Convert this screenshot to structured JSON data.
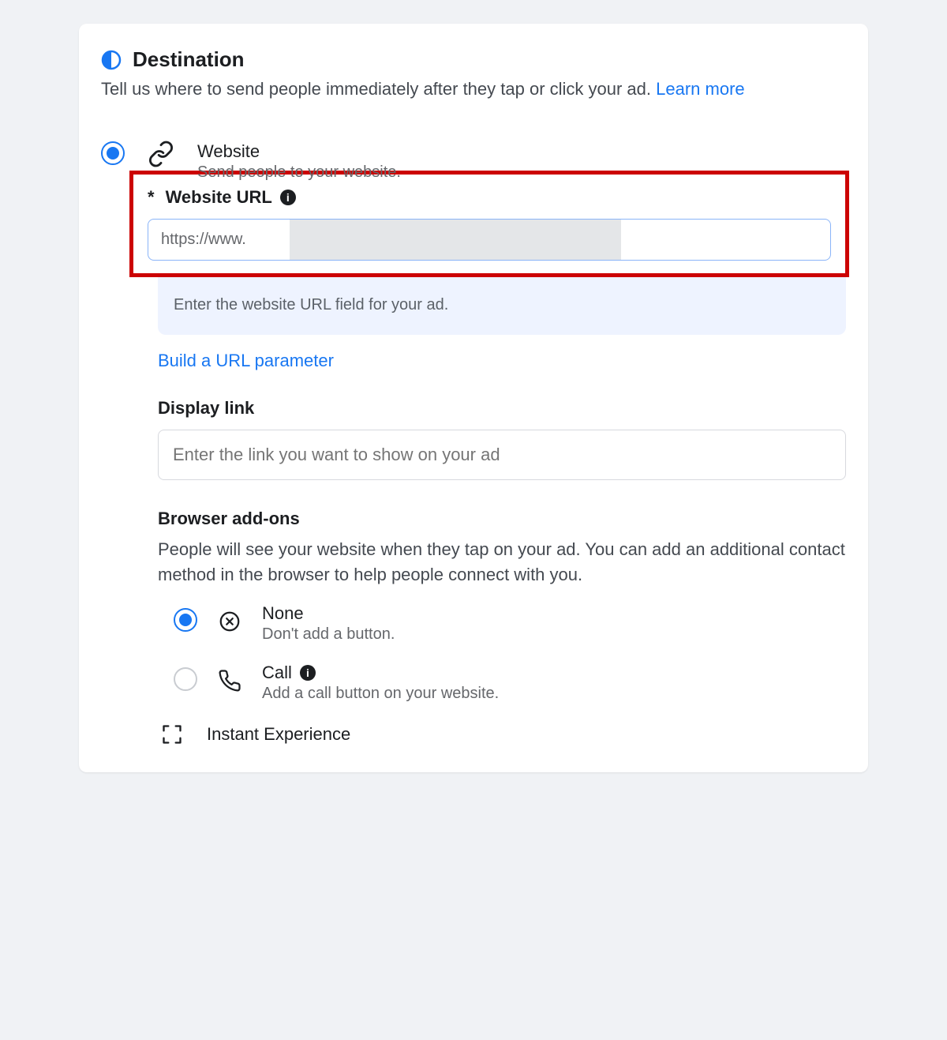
{
  "header": {
    "title": "Destination",
    "description_pre": "Tell us where to send people immediately after they tap or click your ad. ",
    "learn_more": "Learn more"
  },
  "website_option": {
    "label": "Website",
    "desc": "Send people to your website."
  },
  "url_field": {
    "label": "Website URL",
    "value": "https://www.",
    "helper": "Enter the website URL field for your ad."
  },
  "url_param_link": "Build a URL parameter",
  "display_link": {
    "label": "Display link",
    "placeholder": "Enter the link you want to show on your ad"
  },
  "addons": {
    "heading": "Browser add-ons",
    "desc": "People will see your website when they tap on your ad. You can add an additional contact method in the browser to help people connect with you.",
    "none": {
      "label": "None",
      "desc": "Don't add a button."
    },
    "call": {
      "label": "Call",
      "desc": "Add a call button on your website."
    }
  },
  "instant": {
    "label": "Instant Experience"
  }
}
